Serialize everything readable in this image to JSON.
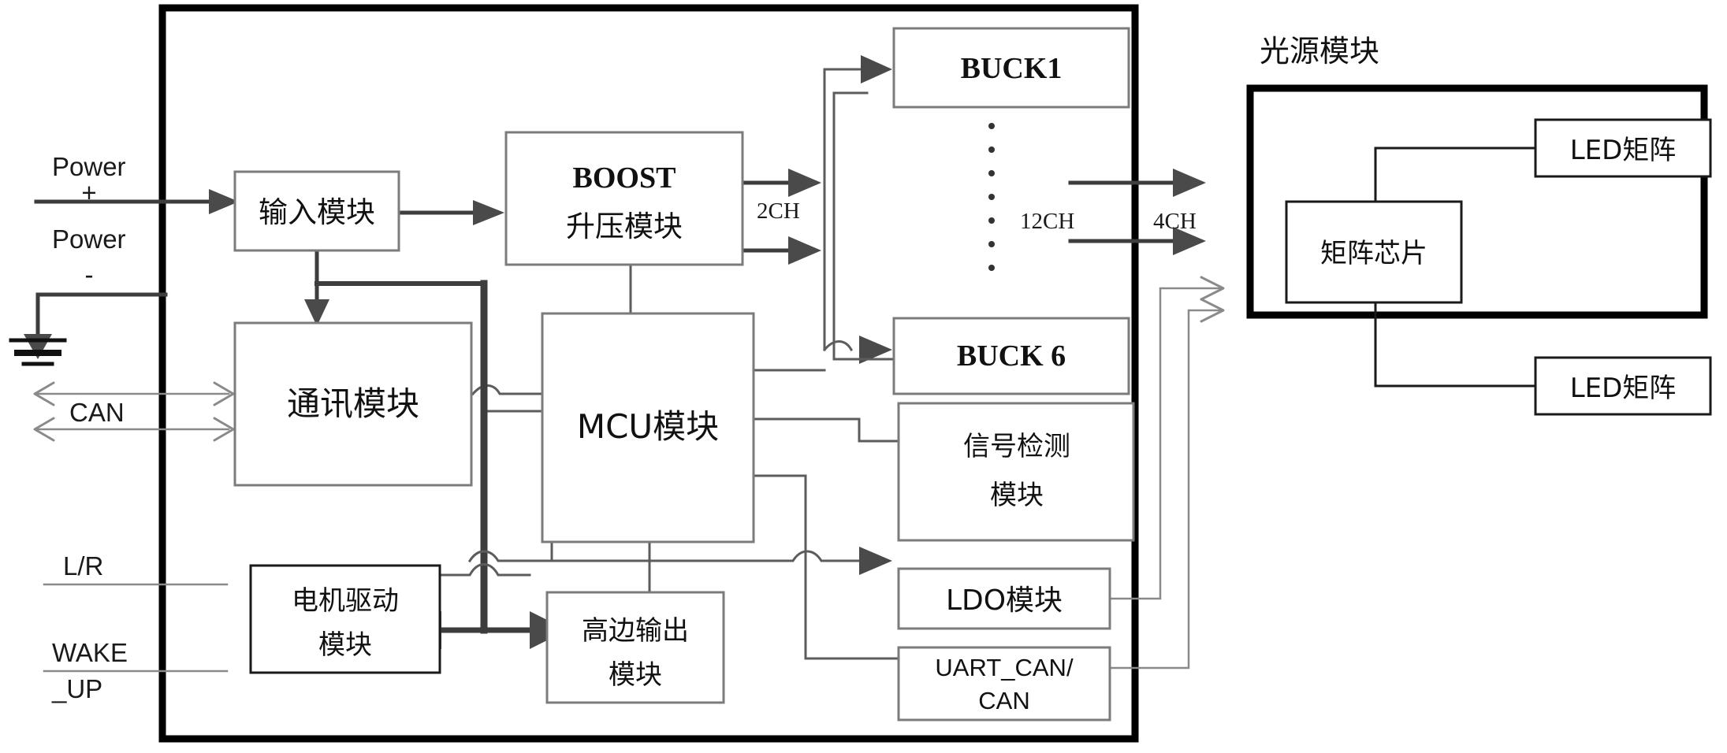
{
  "diagram": {
    "title_right_panel": "光源模块",
    "inputs": [
      {
        "id": "power_plus",
        "line1": "Power",
        "line2": "+"
      },
      {
        "id": "power_minus",
        "line1": "Power",
        "line2": "-"
      },
      {
        "id": "can",
        "label": "CAN"
      },
      {
        "id": "lr",
        "label": "L/R"
      },
      {
        "id": "wake_up",
        "line1": "WAKE",
        "line2": "_UP"
      }
    ],
    "blocks": {
      "input_module": "输入模块",
      "boost_module_l1": "BOOST",
      "boost_module_l2": "升压模块",
      "comm_module": "通讯模块",
      "mcu_module": "MCU模块",
      "buck1": "BUCK1",
      "buck6": "BUCK 6",
      "signal_detect_l1": "信号检测",
      "signal_detect_l2": "模块",
      "ldo_module": "LDO模块",
      "uart_can_l1": "UART_CAN/",
      "uart_can_l2": "CAN",
      "motor_drive_l1": "电机驱动",
      "motor_drive_l2": "模块",
      "highside_out_l1": "高边输出",
      "highside_out_l2": "模块",
      "matrix_chip": "矩阵芯片",
      "led_matrix_top": "LED矩阵",
      "led_matrix_bottom": "LED矩阵"
    },
    "channel_labels": {
      "boost_out": "2CH",
      "buck_total": "12CH",
      "light_out": "4CH"
    },
    "colors": {
      "frame": "#000000",
      "block_stroke": "#7b7b7b",
      "wire": "#5c5c5c",
      "background": "#ffffff"
    }
  }
}
